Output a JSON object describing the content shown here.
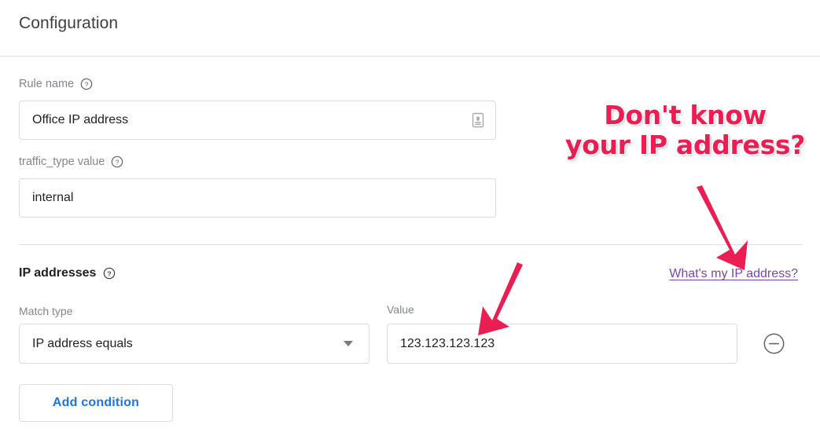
{
  "header": {
    "title": "Configuration"
  },
  "fields": {
    "rule_name": {
      "label": "Rule name",
      "value": "Office IP address",
      "placeholder": "Rule name",
      "help_icon": "help-circle-icon",
      "trailing_icon": "insert-variable-icon"
    },
    "traffic_type": {
      "label": "traffic_type value",
      "value": "internal",
      "placeholder": "traffic_type value",
      "help_icon": "help-circle-icon"
    }
  },
  "ip_section": {
    "title": "IP addresses",
    "help_icon": "help-circle-icon",
    "link": {
      "label": "What's my IP address?",
      "color": "#7b46a5"
    },
    "condition": {
      "match_type_label": "Match type",
      "match_type_value": "IP address equals",
      "match_type_options": [
        "IP address equals"
      ],
      "dropdown_icon": "chevron-down-icon",
      "value_label": "Value",
      "value": "123.123.123.123",
      "value_placeholder": "Value",
      "remove_icon": "remove-circle-icon"
    },
    "add_condition_label": "Add condition",
    "add_condition_color": "#1a73e8"
  },
  "annotation": {
    "line1": "Don't know",
    "line2": "your IP address?",
    "color": "#ea1e52",
    "arrows": [
      {
        "name": "arrow-to-link",
        "direction": "down-right"
      },
      {
        "name": "arrow-to-value-field",
        "direction": "down-left"
      }
    ]
  }
}
